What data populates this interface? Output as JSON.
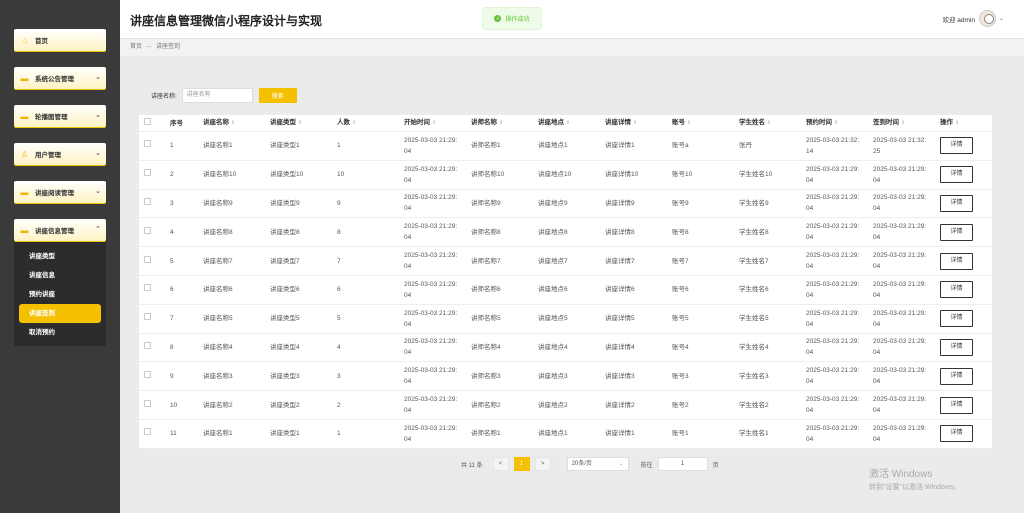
{
  "app": {
    "title": "讲座信息管理微信小程序设计与实现"
  },
  "toast": {
    "text": "操作成功"
  },
  "user": {
    "greeting": "欢迎 admin"
  },
  "breadcrumb": {
    "home": "首页",
    "sep": "—",
    "current": "讲座签到"
  },
  "sidebar": {
    "items": [
      {
        "label": "首页"
      },
      {
        "label": "系统公告管理"
      },
      {
        "label": "轮播图管理"
      },
      {
        "label": "用户管理"
      },
      {
        "label": "讲座阅读管理"
      },
      {
        "label": "讲座信息管理"
      }
    ],
    "submenu": [
      {
        "label": "讲座类型"
      },
      {
        "label": "讲座信息"
      },
      {
        "label": "预约讲座"
      },
      {
        "label": "讲座签到"
      },
      {
        "label": "取消预约"
      }
    ]
  },
  "search": {
    "label": "讲座名称:",
    "placeholder": "讲座名称",
    "button": "搜索"
  },
  "table": {
    "headers": [
      "序号",
      "讲座名称",
      "讲座类型",
      "人数",
      "开始时间",
      "讲师名称",
      "讲座地点",
      "讲座详情",
      "账号",
      "学生姓名",
      "预约时间",
      "签到时间",
      "操作"
    ],
    "detail_label": "详情",
    "rows": [
      [
        "1",
        "讲座名称1",
        "讲座类型1",
        "1",
        "2025-03-03 21:29:",
        "04",
        "讲师名称1",
        "讲座地点1",
        "讲座详情1",
        "账号a",
        "张丹",
        "2025-03-03 21:32:",
        "14",
        "2025-03-03 21:32:",
        "25"
      ],
      [
        "2",
        "讲座名称10",
        "讲座类型10",
        "10",
        "2025-03-03 21:29:",
        "04",
        "讲师名称10",
        "讲座地点10",
        "讲座详情10",
        "账号10",
        "学生姓名10",
        "2025-03-03 21:29:",
        "04",
        "2025-03-03 21:29:",
        "04"
      ],
      [
        "3",
        "讲座名称9",
        "讲座类型9",
        "9",
        "2025-03-03 21:29:",
        "04",
        "讲师名称9",
        "讲座地点9",
        "讲座详情9",
        "账号9",
        "学生姓名9",
        "2025-03-03 21:29:",
        "04",
        "2025-03-03 21:29:",
        "04"
      ],
      [
        "4",
        "讲座名称8",
        "讲座类型8",
        "8",
        "2025-03-03 21:29:",
        "04",
        "讲师名称8",
        "讲座地点8",
        "讲座详情8",
        "账号8",
        "学生姓名8",
        "2025-03-03 21:29:",
        "04",
        "2025-03-03 21:29:",
        "04"
      ],
      [
        "5",
        "讲座名称7",
        "讲座类型7",
        "7",
        "2025-03-03 21:29:",
        "04",
        "讲师名称7",
        "讲座地点7",
        "讲座详情7",
        "账号7",
        "学生姓名7",
        "2025-03-03 21:29:",
        "04",
        "2025-03-03 21:29:",
        "04"
      ],
      [
        "6",
        "讲座名称6",
        "讲座类型6",
        "6",
        "2025-03-03 21:29:",
        "04",
        "讲师名称6",
        "讲座地点6",
        "讲座详情6",
        "账号6",
        "学生姓名6",
        "2025-03-03 21:29:",
        "04",
        "2025-03-03 21:29:",
        "04"
      ],
      [
        "7",
        "讲座名称5",
        "讲座类型5",
        "5",
        "2025-03-03 21:29:",
        "04",
        "讲师名称5",
        "讲座地点5",
        "讲座详情5",
        "账号5",
        "学生姓名5",
        "2025-03-03 21:29:",
        "04",
        "2025-03-03 21:29:",
        "04"
      ],
      [
        "8",
        "讲座名称4",
        "讲座类型4",
        "4",
        "2025-03-03 21:29:",
        "04",
        "讲师名称4",
        "讲座地点4",
        "讲座详情4",
        "账号4",
        "学生姓名4",
        "2025-03-03 21:29:",
        "04",
        "2025-03-03 21:29:",
        "04"
      ],
      [
        "9",
        "讲座名称3",
        "讲座类型3",
        "3",
        "2025-03-03 21:29:",
        "04",
        "讲师名称3",
        "讲座地点3",
        "讲座详情3",
        "账号3",
        "学生姓名3",
        "2025-03-03 21:29:",
        "04",
        "2025-03-03 21:29:",
        "04"
      ],
      [
        "10",
        "讲座名称2",
        "讲座类型2",
        "2",
        "2025-03-03 21:29:",
        "04",
        "讲师名称2",
        "讲座地点2",
        "讲座详情2",
        "账号2",
        "学生姓名2",
        "2025-03-03 21:29:",
        "04",
        "2025-03-03 21:29:",
        "04"
      ],
      [
        "11",
        "讲座名称1",
        "讲座类型1",
        "1",
        "2025-03-03 21:29:",
        "04",
        "讲师名称1",
        "讲座地点1",
        "讲座详情1",
        "账号1",
        "学生姓名1",
        "2025-03-03 21:29:",
        "04",
        "2025-03-03 21:29:",
        "04"
      ]
    ]
  },
  "pagination": {
    "total": "共 11 条",
    "prev": "<",
    "page": "1",
    "next": ">",
    "page_size": "20条/页",
    "goto_label": "前往",
    "goto_value": "1",
    "page_unit": "页"
  },
  "watermark": {
    "line1": "激活 Windows",
    "line2": "转到\"设置\"以激活 Windows。"
  },
  "colors": {
    "accent": "#f5c000",
    "sidebar": "#3a3a3a"
  }
}
